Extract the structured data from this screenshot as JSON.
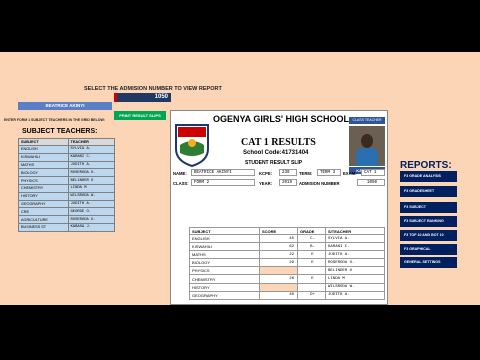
{
  "header": {
    "select_label": "SELECT THE ADMISION NUMBER TO VIEW REPORT",
    "admission_number": "1050",
    "student_name": "BEATRICE AKINYI",
    "enter_label": "ENTER FORM 1 SUBJECT TEACHERS IN THE GRID BELOW:",
    "print_button": "PRINT RESULT SLIPS"
  },
  "subject_teachers": {
    "title": "SUBJECT TEACHERS:",
    "col_subject": "SUBJECT",
    "col_teacher": "TEACHER",
    "rows": [
      {
        "subject": "ENGLISH",
        "teacher": "SYLVIA A."
      },
      {
        "subject": "KISWAHILI",
        "teacher": "KARANI C."
      },
      {
        "subject": "MATHS",
        "teacher": "JUDITH A."
      },
      {
        "subject": "BIOLOGY",
        "teacher": "ROSERODA O."
      },
      {
        "subject": "PHYSICS",
        "teacher": "BELINDER O"
      },
      {
        "subject": "CHEMISTRY",
        "teacher": "LINDA M"
      },
      {
        "subject": "HISTORY",
        "teacher": "WILSRODA W."
      },
      {
        "subject": "GEOGRAPHY",
        "teacher": "JUDITH A."
      },
      {
        "subject": "CRE",
        "teacher": "GEORGE O."
      },
      {
        "subject": "AGRICULTURE",
        "teacher": "ROSERODA O."
      },
      {
        "subject": "BUSINESS ST",
        "teacher": "KABASA J."
      }
    ]
  },
  "slip": {
    "school": "OGENYA GIRLS' HIGH SCHOOL",
    "class_teacher_tag": "CLASS TEACHER",
    "class_teacher_name": "KABASA J.",
    "exam_title": "CAT 1 RESULTS",
    "school_code": "School Code:41731404",
    "slip_label": "STUDENT RESULT SLIP",
    "name_label": "NAME:",
    "name_value": "BEATRICE AKINYI",
    "kcpe_label": "KCPE:",
    "kcpe_value": "239",
    "term_label": "TERM:",
    "term_value": "TERM 3",
    "exam_label": "EXAM:",
    "exam_value": "CAT 1",
    "class_label": "CLASS:",
    "class_value": "FORM 2",
    "year_label": "YEAR:",
    "year_value": "2019",
    "adm_label": "ADMISION NUMBER",
    "adm_value": "1050",
    "table_headers": {
      "subject": "SUBJECT",
      "score": "SCORE",
      "grade": "GRADE",
      "teacher": "S/TEACHER"
    },
    "results": [
      {
        "subject": "ENGLISH",
        "score": "45",
        "grade": "C-",
        "teacher": "SYLVIA A."
      },
      {
        "subject": "KISWAHILI",
        "score": "62",
        "grade": "B-",
        "teacher": "KARANI C."
      },
      {
        "subject": "MATHS",
        "score": "22",
        "grade": "E",
        "teacher": "JUDITH A."
      },
      {
        "subject": "BIOLOGY",
        "score": "29",
        "grade": "E",
        "teacher": "ROSERODA O."
      },
      {
        "subject": "PHYSICS",
        "score": "",
        "grade": "",
        "teacher": "BELINDER O"
      },
      {
        "subject": "CHEMISTRY",
        "score": "26",
        "grade": "E",
        "teacher": "LINDA M"
      },
      {
        "subject": "HISTORY",
        "score": "",
        "grade": "",
        "teacher": "WILSRODA W."
      },
      {
        "subject": "GEOGRAPHY",
        "score": "40",
        "grade": "D+",
        "teacher": "JUDITH A."
      }
    ]
  },
  "reports": {
    "title": "REPORTS:",
    "buttons": [
      "F3 GRADE ANALYSIS",
      "F3 GRADESHEET",
      "F3 SUBJECT",
      "F3 SUBJECT RANKING",
      "F3 TOP 10 AND BOT 10",
      "F3 GRAPHICAL",
      "GENERAL SETTINGS"
    ]
  },
  "colors": {
    "accent": "#002060",
    "print": "#00a651",
    "teacher_grid": "#bdd7ee",
    "physics_row": "#fbd5b5"
  }
}
